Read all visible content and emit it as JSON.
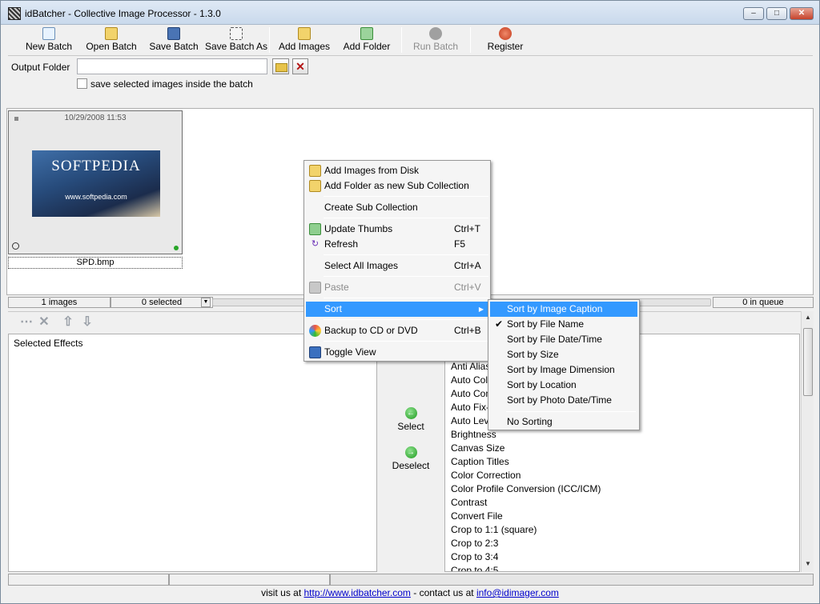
{
  "window": {
    "title": "idBatcher - Collective Image Processor - 1.3.0"
  },
  "toolbar": {
    "new_batch": "New Batch",
    "open_batch": "Open Batch",
    "save_batch": "Save Batch",
    "save_batch_as": "Save Batch As",
    "add_images": "Add Images",
    "add_folder": "Add Folder",
    "run_batch": "Run Batch",
    "register": "Register"
  },
  "output": {
    "label": "Output Folder",
    "value": "",
    "save_inside_label": "save selected images inside the batch"
  },
  "gallery": {
    "thumb": {
      "date": "10/29/2008 11:53",
      "brand": "SOFTPEDIA",
      "brand_url": "www.softpedia.com",
      "filename": "SPD.bmp"
    }
  },
  "status": {
    "images": "1 images",
    "selected": "0 selected",
    "queue": "0 in queue"
  },
  "effects": {
    "selected_header": "Selected Effects",
    "select_label": "Select",
    "deselect_label": "Deselect",
    "list": [
      "Anti Alias",
      "Auto Colo",
      "Auto Cont",
      "Auto Fix-U",
      "Auto Leve",
      "Brightness",
      "Canvas Size",
      "Caption Titles",
      "Color Correction",
      "Color Profile Conversion (ICC/ICM)",
      "Contrast",
      "Convert File",
      "Crop to 1:1 (square)",
      "Crop to 2:3",
      "Crop to 3:4",
      "Crop to 4:5"
    ]
  },
  "context_menu": {
    "add_images_from_disk": "Add Images from Disk",
    "add_folder_sub": "Add Folder as new Sub Collection",
    "create_sub": "Create Sub Collection",
    "update_thumbs": "Update Thumbs",
    "update_thumbs_sc": "Ctrl+T",
    "refresh": "Refresh",
    "refresh_sc": "F5",
    "select_all": "Select All Images",
    "select_all_sc": "Ctrl+A",
    "paste": "Paste",
    "paste_sc": "Ctrl+V",
    "sort": "Sort",
    "backup": "Backup to CD or DVD",
    "backup_sc": "Ctrl+B",
    "toggle_view": "Toggle View"
  },
  "sort_menu": {
    "by_caption": "Sort by Image Caption",
    "by_file_name": "Sort by File Name",
    "by_file_date": "Sort by File Date/Time",
    "by_size": "Sort by Size",
    "by_dimension": "Sort by Image Dimension",
    "by_location": "Sort by Location",
    "by_photo_date": "Sort by Photo Date/Time",
    "no_sorting": "No Sorting",
    "checked": "Sort by File Name"
  },
  "footer": {
    "prefix": "visit us at",
    "url": "http://www.idbatcher.com",
    "middle": "- contact us at",
    "email": "info@idimager.com"
  },
  "colors": {
    "highlight": "#3399ff",
    "link": "#0000cc"
  }
}
